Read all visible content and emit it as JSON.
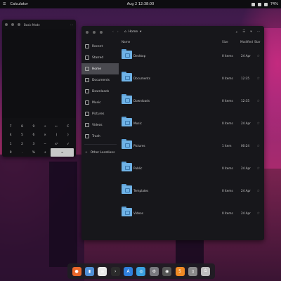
{
  "topbar": {
    "app_name": "Calculator",
    "clock": "Aug 2  12:38:00",
    "battery": "74%"
  },
  "calculator": {
    "mode": "Basic Mode",
    "keys": [
      "7",
      "8",
      "9",
      "÷",
      "←",
      "C",
      "4",
      "5",
      "6",
      "×",
      "(",
      ")",
      "1",
      "2",
      "3",
      "−",
      "x²",
      "√",
      "0",
      ".",
      "%",
      "+",
      "="
    ]
  },
  "files": {
    "location": "Home",
    "columns": {
      "name": "Name",
      "size": "Size",
      "modified": "Modified",
      "star": "Star"
    },
    "sidebar": [
      {
        "label": "Recent",
        "icon": "clock-icon"
      },
      {
        "label": "Starred",
        "icon": "star-icon"
      },
      {
        "label": "Home",
        "icon": "home-icon",
        "active": true
      },
      {
        "label": "Documents",
        "icon": "document-icon"
      },
      {
        "label": "Downloads",
        "icon": "download-icon"
      },
      {
        "label": "Music",
        "icon": "music-icon"
      },
      {
        "label": "Pictures",
        "icon": "picture-icon"
      },
      {
        "label": "Videos",
        "icon": "video-icon"
      },
      {
        "label": "Trash",
        "icon": "trash-icon"
      },
      {
        "label": "Other Locations",
        "icon": "plus-icon"
      }
    ],
    "rows": [
      {
        "name": "Desktop",
        "size": "0 items",
        "modified": "24 Apr"
      },
      {
        "name": "Documents",
        "size": "0 items",
        "modified": "12:35"
      },
      {
        "name": "Downloads",
        "size": "0 items",
        "modified": "12:35"
      },
      {
        "name": "Music",
        "size": "0 items",
        "modified": "24 Apr"
      },
      {
        "name": "Pictures",
        "size": "1 item",
        "modified": "00:24"
      },
      {
        "name": "Public",
        "size": "0 items",
        "modified": "24 Apr"
      },
      {
        "name": "Templates",
        "size": "0 items",
        "modified": "24 Apr"
      },
      {
        "name": "Videos",
        "size": "0 items",
        "modified": "24 Apr"
      }
    ]
  },
  "dock": {
    "apps": [
      {
        "name": "firefox-icon",
        "color": "#e8672a",
        "glyph": "●"
      },
      {
        "name": "files-icon",
        "color": "#4f8fd6",
        "glyph": "▮"
      },
      {
        "name": "text-editor-icon",
        "color": "#e9e9e9",
        "glyph": "≡"
      },
      {
        "name": "terminal-icon",
        "color": "#2b2b2b",
        "glyph": "›"
      },
      {
        "name": "app-store-icon",
        "color": "#2f7fdc",
        "glyph": "A"
      },
      {
        "name": "web-icon",
        "color": "#3aa0e0",
        "glyph": "◎"
      },
      {
        "name": "settings-icon",
        "color": "#7a7a80",
        "glyph": "⚙"
      },
      {
        "name": "system-monitor-icon",
        "color": "#555",
        "glyph": "◉"
      },
      {
        "name": "calculator-icon",
        "color": "#f08a24",
        "glyph": "5"
      },
      {
        "name": "trash-icon",
        "color": "#8a8a8a",
        "glyph": "▯"
      },
      {
        "name": "power-icon",
        "color": "#bfbfbf",
        "glyph": "⏻"
      }
    ]
  }
}
